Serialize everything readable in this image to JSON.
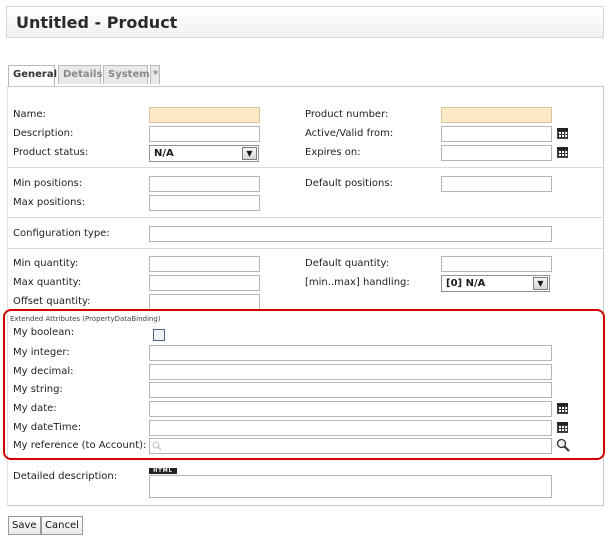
{
  "window": {
    "title": "Untitled - Product"
  },
  "tabs": [
    {
      "label": "General",
      "active": true
    },
    {
      "label": "Details",
      "active": false
    },
    {
      "label": "System",
      "active": false
    },
    {
      "label": "*",
      "active": false
    }
  ],
  "fields": {
    "name": {
      "label": "Name:",
      "value": ""
    },
    "product_number": {
      "label": "Product number:",
      "value": ""
    },
    "description": {
      "label": "Description:",
      "value": ""
    },
    "active_from": {
      "label": "Active/Valid from:",
      "value": ""
    },
    "product_status": {
      "label": "Product status:",
      "value": "N/A"
    },
    "expires_on": {
      "label": "Expires on:",
      "value": ""
    },
    "min_positions": {
      "label": "Min positions:",
      "value": ""
    },
    "default_positions": {
      "label": "Default positions:",
      "value": ""
    },
    "max_positions": {
      "label": "Max positions:",
      "value": ""
    },
    "configuration_type": {
      "label": "Configuration type:",
      "value": ""
    },
    "min_quantity": {
      "label": "Min quantity:",
      "value": ""
    },
    "default_quantity": {
      "label": "Default quantity:",
      "value": ""
    },
    "max_quantity": {
      "label": "Max quantity:",
      "value": ""
    },
    "minmax_handling": {
      "label": "[min..max] handling:",
      "value": "[0] N/A"
    },
    "offset_quantity": {
      "label": "Offset quantity:",
      "value": ""
    }
  },
  "extended": {
    "title": "Extended Attributes (PropertyDataBinding)",
    "my_boolean": {
      "label": "My boolean:",
      "checked": false
    },
    "my_integer": {
      "label": "My integer:",
      "value": ""
    },
    "my_decimal": {
      "label": "My decimal:",
      "value": ""
    },
    "my_string": {
      "label": "My string:",
      "value": ""
    },
    "my_date": {
      "label": "My date:",
      "value": ""
    },
    "my_datetime": {
      "label": "My dateTime:",
      "value": ""
    },
    "my_reference": {
      "label": "My reference (to Account):",
      "value": ""
    }
  },
  "detailed_description": {
    "label": "Detailed description:",
    "editor_badge": "HTML",
    "value": ""
  },
  "buttons": {
    "save": "Save",
    "cancel": "Cancel"
  },
  "colors": {
    "required_field": "#fde9c3",
    "highlight_border": "#d40000"
  },
  "icons": {
    "calendar": "calendar-icon",
    "search": "search-icon",
    "dropdown": "chevron-down-icon"
  }
}
